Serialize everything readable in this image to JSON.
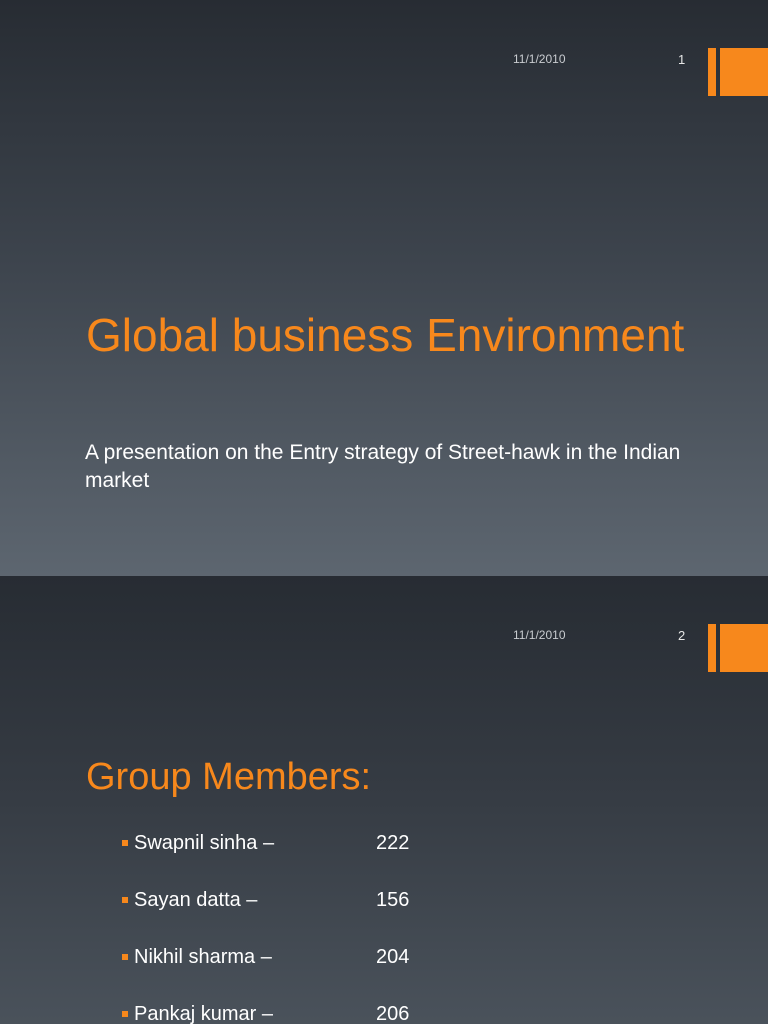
{
  "slides": [
    {
      "date": "11/1/2010",
      "number": "1",
      "title": "Global business Environment",
      "subtitle": "A presentation on the Entry strategy of Street-hawk in the Indian market"
    },
    {
      "date": "11/1/2010",
      "number": "2",
      "title": "Group Members:",
      "members": [
        {
          "name": "Swapnil sinha –",
          "roll": "222"
        },
        {
          "name": "Sayan datta –",
          "roll": "156"
        },
        {
          "name": "Nikhil sharma –",
          "roll": "204"
        },
        {
          "name": "Pankaj kumar –",
          "roll": "206"
        }
      ]
    }
  ],
  "colors": {
    "accent": "#f7881c",
    "text": "#ffffff",
    "background_dark": "#272c33",
    "background_light": "#5d6670"
  }
}
